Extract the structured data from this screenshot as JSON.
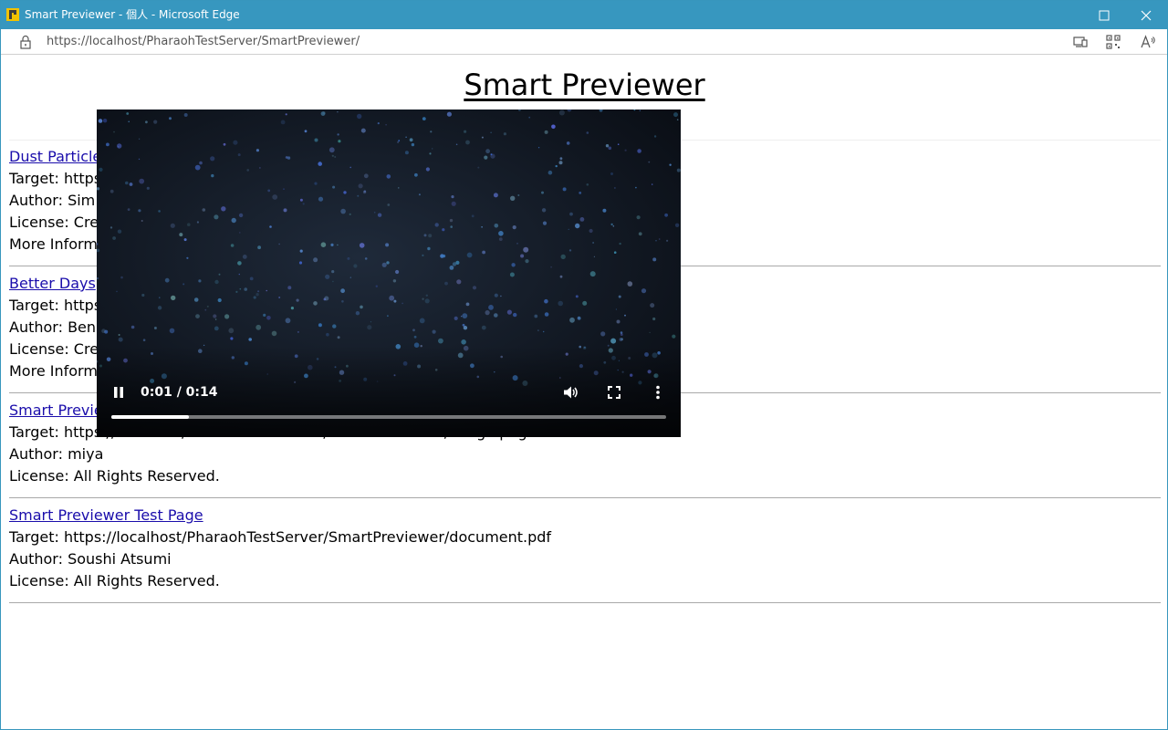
{
  "window": {
    "title": "Smart Previewer - 個人 - Microsoft Edge"
  },
  "addressbar": {
    "url": "https://localhost/PharaohTestServer/SmartPreviewer/"
  },
  "page": {
    "title": "Smart Previewer",
    "entries": [
      {
        "link": "Dust Particle",
        "target": "Target: https",
        "author": "Author: Sim",
        "license": "License: Cre",
        "more": "More Inform"
      },
      {
        "link": "Better Days",
        "target": "Target: https",
        "author": "Author: Ben",
        "license": "License: Cre",
        "more": "More Inform"
      },
      {
        "link": "Smart Previe",
        "target": "Target: https://localhost/PharaohTestServer/SmartPreviewer/image.png",
        "author": "Author: miya",
        "license": "License: All Rights Reserved."
      },
      {
        "link": "Smart Previewer Test Page",
        "target": "Target: https://localhost/PharaohTestServer/SmartPreviewer/document.pdf",
        "author": "Author: Soushi Atsumi",
        "license": "License: All Rights Reserved."
      }
    ]
  },
  "video": {
    "time": "0:01 / 0:14",
    "progress_fraction": 0.14
  },
  "colors": {
    "titlebar": "#3797bf",
    "link": "#1a0dab"
  }
}
